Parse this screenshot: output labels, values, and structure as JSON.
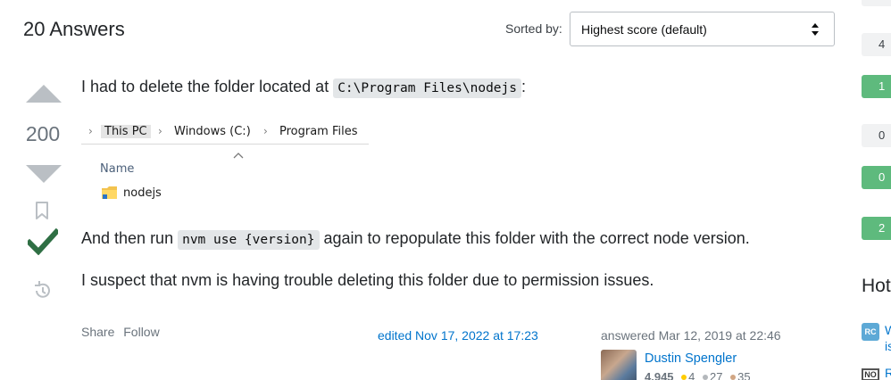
{
  "header": {
    "answers_count_label": "20 Answers",
    "sort_label": "Sorted by:",
    "sort_value": "Highest score (default)"
  },
  "answer": {
    "score": "200",
    "accepted": true,
    "paragraph1_text": "I had to delete the folder located at ",
    "paragraph1_code": "C:\\Program Files\\nodejs",
    "paragraph1_suffix": ":",
    "paragraph2_prefix": "And then run ",
    "paragraph2_code": "nvm use {version}",
    "paragraph2_suffix": " again to repopulate this folder with the correct node version.",
    "paragraph3": "I suspect that nvm is having trouble deleting this folder due to permission issues.",
    "explorer": {
      "breadcrumbs": [
        "This PC",
        "Windows (C:)",
        "Program Files"
      ],
      "column_header": "Name",
      "item": "nodejs"
    },
    "menu": {
      "share": "Share",
      "follow": "Follow"
    },
    "edited": "edited Nov 17, 2022 at 17:23",
    "answered": "answered Mar 12, 2019 at 22:46",
    "user": {
      "name": "Dustin Spengler",
      "reputation": "4,945",
      "gold": "4",
      "silver": "27",
      "bronze": "35"
    }
  },
  "sidebar": {
    "badges": [
      "4",
      "1",
      "0",
      "0",
      "2"
    ],
    "hot_heading": "Hot",
    "hot_items": [
      {
        "icon": "RC",
        "text_line1": "W",
        "text_line2": "is"
      },
      {
        "icon": "NO",
        "text_line1": "R"
      }
    ]
  },
  "colors": {
    "accent_link": "#0074cc",
    "accepted_green": "#2f6f44",
    "badge_green": "#5eba7d",
    "gold": "#ffcc01",
    "silver": "#b4b8bc",
    "bronze": "#d1a684"
  }
}
